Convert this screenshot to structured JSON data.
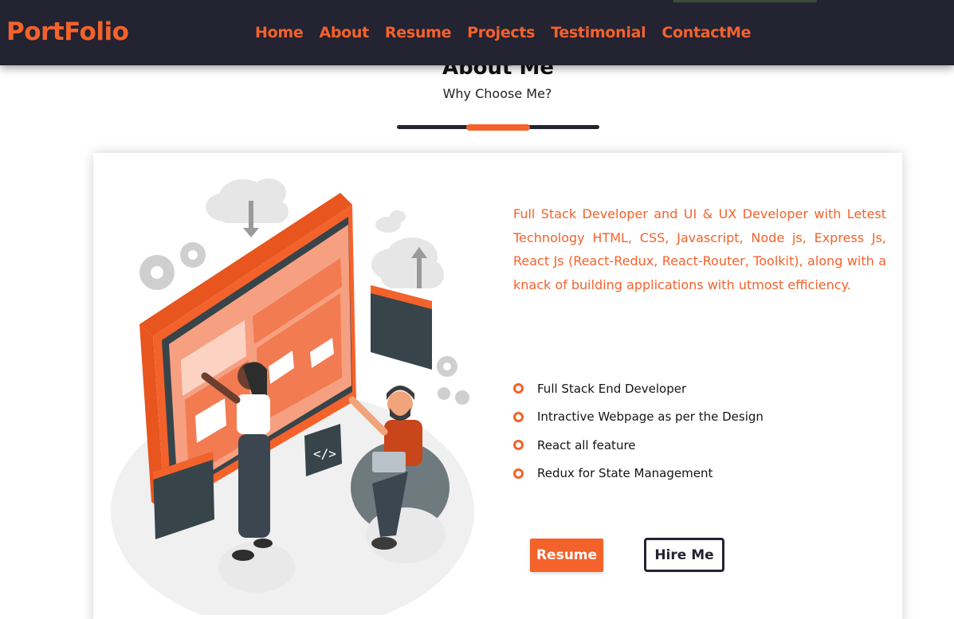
{
  "navbar": {
    "brand": "PortFolio",
    "links": [
      {
        "label": "Home"
      },
      {
        "label": "About"
      },
      {
        "label": "Resume"
      },
      {
        "label": "Projects"
      },
      {
        "label": "Testimonial"
      },
      {
        "label": "ContactMe"
      }
    ]
  },
  "section": {
    "title": "About Me",
    "subtitle": "Why Choose Me?"
  },
  "about": {
    "intro": "Full Stack Developer and UI & UX Developer with Letest Technology HTML, CSS, Javascript, Node js, Express Js, React Js (React-Redux, React-Router, Toolkit), along with a knack of building applications with utmost efficiency.",
    "features": [
      "Full Stack End Developer",
      "Intractive Webpage as per the Design",
      "React all feature",
      "Redux for State Management"
    ],
    "buttons": {
      "resume": "Resume",
      "hire": "Hire Me"
    }
  },
  "illustration": {
    "code_badge": "</>"
  },
  "colors": {
    "accent": "#f4622b",
    "dark": "#232332",
    "card": "#ffffff"
  }
}
